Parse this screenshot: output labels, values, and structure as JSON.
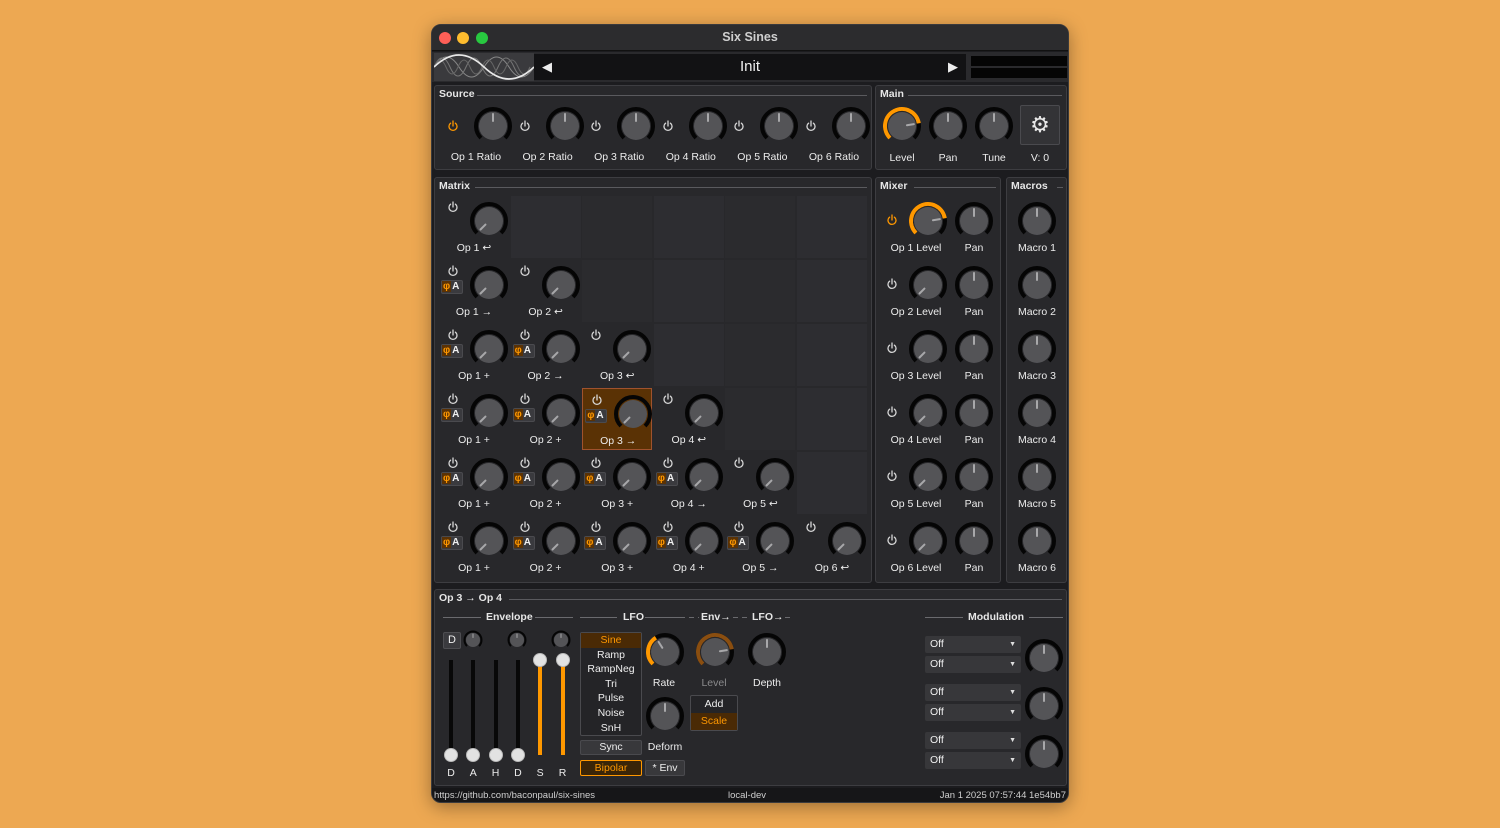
{
  "window": {
    "title": "Six Sines"
  },
  "header": {
    "preset_name": "Init",
    "prev_icon": "◀",
    "next_icon": "▶"
  },
  "source": {
    "title": "Source",
    "ops": [
      {
        "label": "Op 1 Ratio",
        "power_on": true,
        "value": 0.5
      },
      {
        "label": "Op 2 Ratio",
        "power_on": false,
        "value": 0.5
      },
      {
        "label": "Op 3 Ratio",
        "power_on": false,
        "value": 0.5
      },
      {
        "label": "Op 4 Ratio",
        "power_on": false,
        "value": 0.5
      },
      {
        "label": "Op 5 Ratio",
        "power_on": false,
        "value": 0.5
      },
      {
        "label": "Op 6 Ratio",
        "power_on": false,
        "value": 0.5
      }
    ]
  },
  "main": {
    "title": "Main",
    "knobs": [
      {
        "label": "Level",
        "value": 0.8,
        "active": true
      },
      {
        "label": "Pan",
        "value": 0.5,
        "active": false
      },
      {
        "label": "Tune",
        "value": 0.5,
        "active": false
      }
    ],
    "voices_label": "V: 0",
    "settings_icon": "⚙"
  },
  "matrix": {
    "title": "Matrix",
    "phase_symbol": "φ",
    "amp_symbol": "A",
    "rows": [
      [
        {
          "label": "Op 1 ↩",
          "type": "self"
        }
      ],
      [
        {
          "label": "Op 1 →",
          "type": "mod"
        },
        {
          "label": "Op 2 ↩",
          "type": "self"
        }
      ],
      [
        {
          "label": "Op 1 +",
          "type": "mod"
        },
        {
          "label": "Op 2 →",
          "type": "mod"
        },
        {
          "label": "Op 3 ↩",
          "type": "self"
        }
      ],
      [
        {
          "label": "Op 1 +",
          "type": "mod"
        },
        {
          "label": "Op 2 +",
          "type": "mod"
        },
        {
          "label": "Op 3 →",
          "type": "mod",
          "selected": true
        },
        {
          "label": "Op 4 ↩",
          "type": "self"
        }
      ],
      [
        {
          "label": "Op 1 +",
          "type": "mod"
        },
        {
          "label": "Op 2 +",
          "type": "mod"
        },
        {
          "label": "Op 3 +",
          "type": "mod"
        },
        {
          "label": "Op 4 →",
          "type": "mod"
        },
        {
          "label": "Op 5 ↩",
          "type": "self"
        }
      ],
      [
        {
          "label": "Op 1 +",
          "type": "mod"
        },
        {
          "label": "Op 2 +",
          "type": "mod"
        },
        {
          "label": "Op 3 +",
          "type": "mod"
        },
        {
          "label": "Op 4 +",
          "type": "mod"
        },
        {
          "label": "Op 5 →",
          "type": "mod"
        },
        {
          "label": "Op 6 ↩",
          "type": "self"
        }
      ]
    ]
  },
  "mixer": {
    "title": "Mixer",
    "rows": [
      {
        "level_label": "Op 1 Level",
        "pan_label": "Pan",
        "power_on": true,
        "level": 0.8
      },
      {
        "level_label": "Op 2 Level",
        "pan_label": "Pan",
        "power_on": false,
        "level": 0.0
      },
      {
        "level_label": "Op 3 Level",
        "pan_label": "Pan",
        "power_on": false,
        "level": 0.0
      },
      {
        "level_label": "Op 4 Level",
        "pan_label": "Pan",
        "power_on": false,
        "level": 0.0
      },
      {
        "level_label": "Op 5 Level",
        "pan_label": "Pan",
        "power_on": false,
        "level": 0.0
      },
      {
        "level_label": "Op 6 Level",
        "pan_label": "Pan",
        "power_on": false,
        "level": 0.0
      }
    ]
  },
  "macros": {
    "title": "Macros",
    "items": [
      "Macro 1",
      "Macro 2",
      "Macro 3",
      "Macro 4",
      "Macro 5",
      "Macro 6"
    ]
  },
  "editor": {
    "title": "Op 3 → Op 4",
    "envelope": {
      "title": "Envelope",
      "d_button": "D",
      "sliders": [
        {
          "label": "D",
          "value": 0.0
        },
        {
          "label": "A",
          "value": 0.0
        },
        {
          "label": "H",
          "value": 0.0
        },
        {
          "label": "D",
          "value": 0.0
        },
        {
          "label": "S",
          "value": 1.0
        },
        {
          "label": "R",
          "value": 1.0
        }
      ]
    },
    "lfo": {
      "title": "LFO",
      "shapes": [
        "Sine",
        "Ramp",
        "RampNeg",
        "Tri",
        "Pulse",
        "Noise",
        "SnH"
      ],
      "selected_shape": "Sine",
      "sync_label": "Sync",
      "bipolar_label": "Bipolar",
      "rate_label": "Rate",
      "deform_label": "Deform",
      "env_mult_label": "* Env"
    },
    "env_to": {
      "title": "Env→",
      "level_label": "Level",
      "add_label": "Add",
      "scale_label": "Scale",
      "selected": "Scale"
    },
    "lfo_to": {
      "title": "LFO→",
      "depth_label": "Depth"
    },
    "modulation": {
      "title": "Modulation",
      "slots": [
        {
          "source": "Off",
          "via": "Off"
        },
        {
          "source": "Off",
          "via": "Off"
        },
        {
          "source": "Off",
          "via": "Off"
        }
      ]
    }
  },
  "footer": {
    "url": "https://github.com/baconpaul/six-sines",
    "build": "local-dev",
    "version": "Jan  1 2025 07:57:44 1e54bb7"
  },
  "colors": {
    "accent": "#ff9800",
    "background": "#eda852",
    "panel": "#28282b"
  }
}
